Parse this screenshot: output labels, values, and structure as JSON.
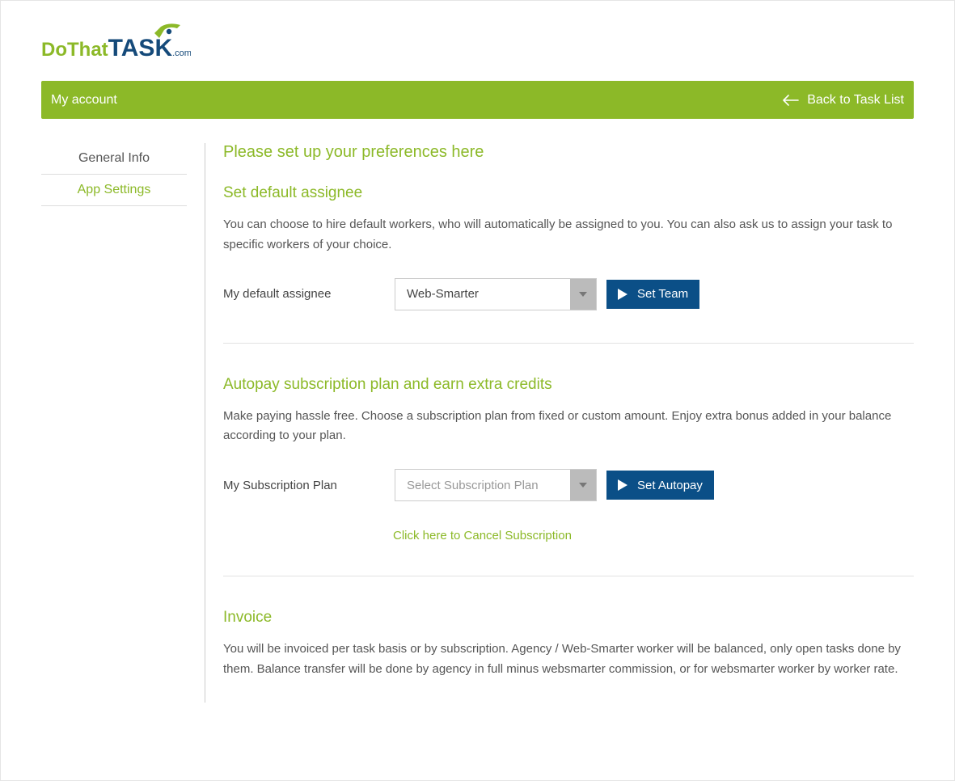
{
  "logo": {
    "part1": "DoThat",
    "part2": "TAS",
    "part3": "K",
    "suffix": ".com"
  },
  "topbar": {
    "title": "My account",
    "back_label": "Back to Task List"
  },
  "sidebar": {
    "items": [
      {
        "label": "General Info",
        "active": false
      },
      {
        "label": "App Settings",
        "active": true
      }
    ]
  },
  "main": {
    "page_heading": "Please set up your preferences here",
    "assignee": {
      "heading": "Set default assignee",
      "desc": "You can choose to hire default workers, who will automatically be assigned to you. You can also ask us to assign your task to specific workers of your choice.",
      "field_label": "My default assignee",
      "select_value": "Web-Smarter",
      "button_label": "Set Team"
    },
    "autopay": {
      "heading": "Autopay subscription plan and earn extra credits",
      "desc": "Make paying hassle free. Choose a subscription plan from fixed or custom amount. Enjoy extra bonus added in your balance according to your plan.",
      "field_label": "My Subscription Plan",
      "select_placeholder": "Select Subscription Plan",
      "button_label": "Set Autopay",
      "cancel_link": "Click here to Cancel Subscription"
    },
    "invoice": {
      "heading": "Invoice",
      "desc": "You will be invoiced per task basis or by subscription. Agency / Web-Smarter worker will be balanced, only open tasks done by them. Balance transfer will be done by agency in full minus websmarter commission, or for websmarter worker by worker rate."
    }
  }
}
